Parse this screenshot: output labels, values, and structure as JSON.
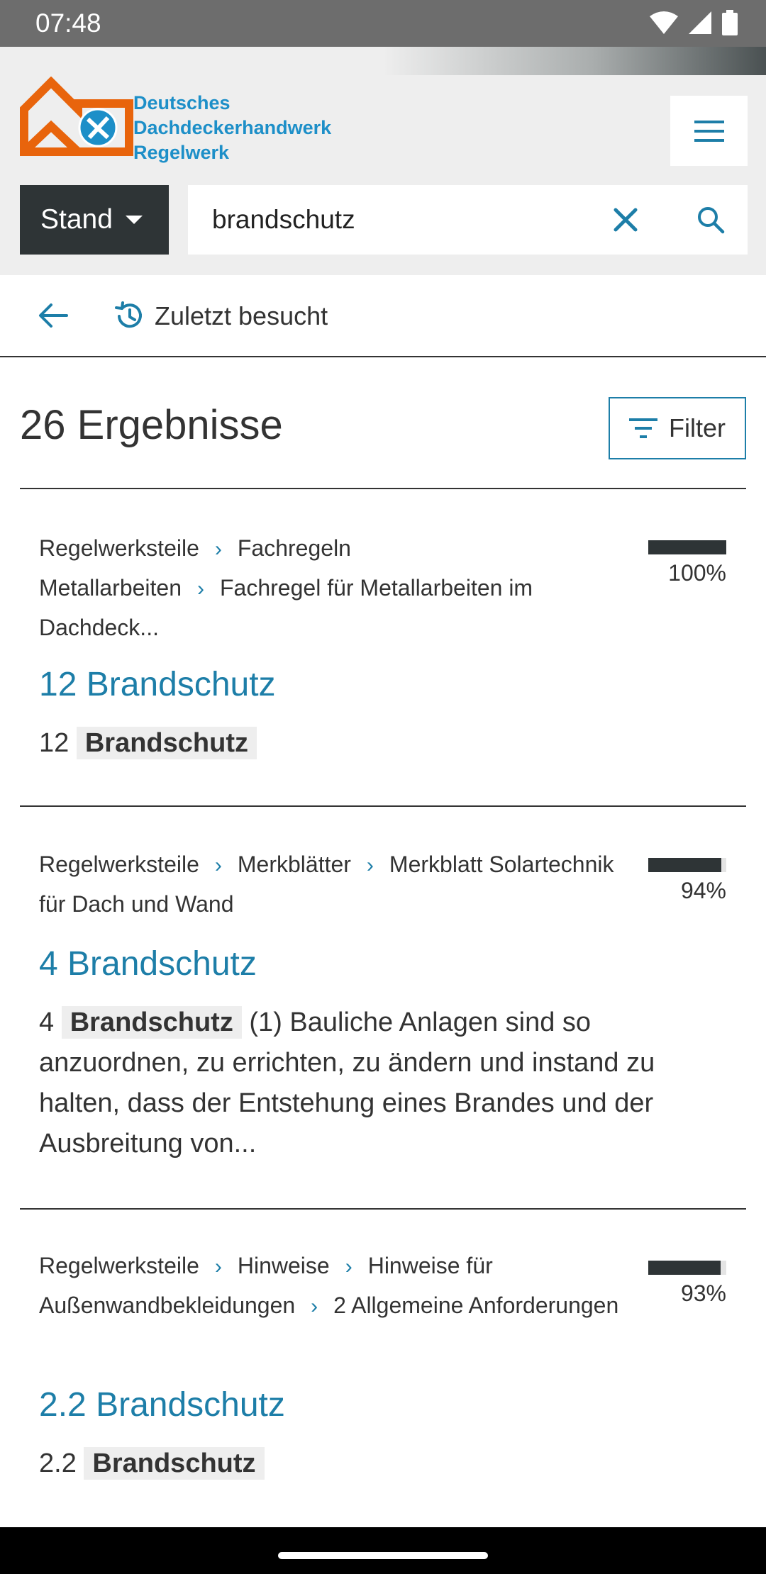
{
  "status": {
    "time": "07:48"
  },
  "header": {
    "logo_lines": [
      "Deutsches",
      "Dachdeckerhandwerk",
      "Regelwerk"
    ],
    "stand_label": "Stand",
    "search_value": "brandschutz",
    "search_placeholder": ""
  },
  "nav": {
    "recent_label": "Zuletzt besucht"
  },
  "results_header": {
    "count_text": "26 Ergebnisse",
    "filter_label": "Filter"
  },
  "results": [
    {
      "breadcrumb": [
        "Regelwerksteile",
        "Fachregeln",
        "Metallarbeiten",
        "Fachregel für Metallarbeiten im Dachdeck..."
      ],
      "score": 100,
      "score_label": "100%",
      "title": "12 Brandschutz",
      "body_prefix": "12",
      "body_highlight": "Brandschutz",
      "body_rest": ""
    },
    {
      "breadcrumb": [
        "Regelwerksteile",
        "Merkblätter",
        "Merkblatt Solartechnik für Dach und Wand"
      ],
      "score": 94,
      "score_label": "94%",
      "title": "4 Brandschutz",
      "body_prefix": "4",
      "body_highlight": "Brandschutz",
      "body_rest": "(1) Bauliche Anlagen sind so anzuordnen, zu errichten, zu ändern und instand zu halten, dass der Entstehung eines Brandes und der Ausbreitung von..."
    },
    {
      "breadcrumb": [
        "Regelwerksteile",
        "Hinweise",
        "Hinweise für Außenwandbekleidungen",
        "2 Allgemeine Anforderungen"
      ],
      "score": 93,
      "score_label": "93%",
      "title": "2.2 Brandschutz",
      "body_prefix": "2.2",
      "body_highlight": "Brandschutz",
      "body_rest": ""
    }
  ],
  "colors": {
    "accent": "#1d7ea8",
    "logo_orange": "#e8640c",
    "logo_blue": "#1d8fc8",
    "dark": "#2e3436"
  }
}
